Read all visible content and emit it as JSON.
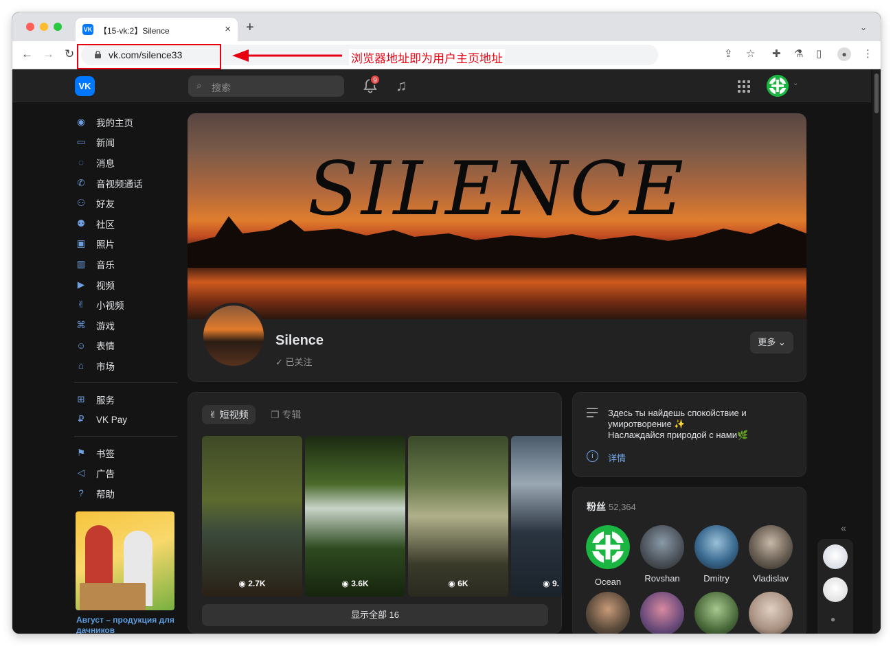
{
  "browser": {
    "tab_title": "【15-vk:2】Silence",
    "tab_favicon": "VK",
    "url": "vk.com/silence33",
    "annotation": "浏览器地址即为用户主页地址"
  },
  "header": {
    "logo": "VK",
    "search_placeholder": "搜索",
    "notification_count": "9"
  },
  "sidebar": {
    "items": [
      {
        "label": "我的主页",
        "icon": "profile-icon"
      },
      {
        "label": "新闻",
        "icon": "news-icon"
      },
      {
        "label": "消息",
        "icon": "messages-icon"
      },
      {
        "label": "音视频通话",
        "icon": "phone-icon"
      },
      {
        "label": "好友",
        "icon": "friends-icon"
      },
      {
        "label": "社区",
        "icon": "communities-icon"
      },
      {
        "label": "照片",
        "icon": "photos-icon"
      },
      {
        "label": "音乐",
        "icon": "music-icon"
      },
      {
        "label": "视频",
        "icon": "video-icon"
      },
      {
        "label": "小视频",
        "icon": "clips-icon"
      },
      {
        "label": "游戏",
        "icon": "games-icon"
      },
      {
        "label": "表情",
        "icon": "stickers-icon"
      },
      {
        "label": "市场",
        "icon": "market-icon"
      }
    ],
    "items2": [
      {
        "label": "服务",
        "icon": "services-icon"
      },
      {
        "label": "VK Pay",
        "icon": "vkpay-icon"
      }
    ],
    "items3": [
      {
        "label": "书签",
        "icon": "bookmarks-icon"
      },
      {
        "label": "广告",
        "icon": "ads-icon"
      },
      {
        "label": "帮助",
        "icon": "help-icon"
      }
    ],
    "promo_text": "Август – продукция для дачников"
  },
  "profile": {
    "cover_text": "SILENCE",
    "name": "Silence",
    "status": "已关注",
    "more_button": "更多"
  },
  "shorts": {
    "tab_active": "短视频",
    "tab_inactive": "专辑",
    "tiles": [
      {
        "views": "2.7K"
      },
      {
        "views": "3.6K"
      },
      {
        "views": "6K"
      },
      {
        "views": "9."
      }
    ],
    "show_all": "显示全部 16"
  },
  "info": {
    "text_line1": "Здесь ты найдешь спокойствие и",
    "text_line2": "умиротворение ✨",
    "text_line3": "Наслаждайся природой с нами🌿",
    "details": "详情"
  },
  "fans": {
    "title": "粉丝",
    "count": "52,364",
    "people": [
      {
        "name": "Ocean"
      },
      {
        "name": "Rovshan"
      },
      {
        "name": "Dmitry"
      },
      {
        "name": "Vladislav"
      }
    ]
  },
  "colors": {
    "accent": "#0077ff",
    "link": "#71aaeb",
    "annotation": "#e60012",
    "background": "#141414",
    "card": "#222222"
  }
}
